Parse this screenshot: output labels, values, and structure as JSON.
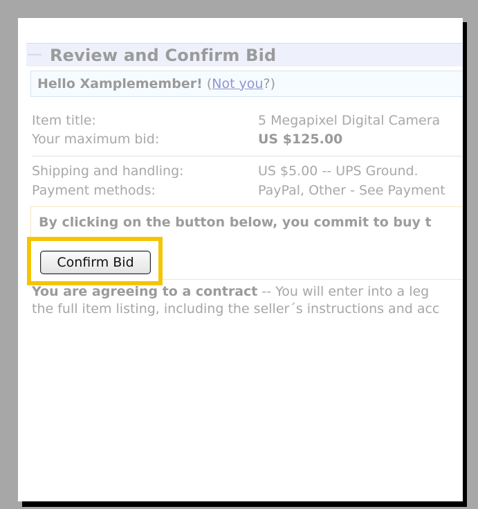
{
  "page": {
    "title": "Review and Confirm Bid",
    "greeting": "Hello Xamplemember!",
    "not_you_open": "(",
    "not_you_link": "Not you",
    "not_you_close": "?)"
  },
  "item": {
    "title_label": "Item title:",
    "title_value": "5 Megapixel Digital Camera",
    "max_bid_label": "Your maximum bid:",
    "max_bid_value": "US $125.00",
    "shipping_label": "Shipping and handling:",
    "shipping_value": "US $5.00 -- UPS Ground.",
    "payment_label": "Payment methods:",
    "payment_value": "PayPal, Other - See Payment"
  },
  "commit": {
    "notice": "By clicking on the button below, you commit to buy t",
    "confirm_label": "Confirm Bid"
  },
  "agreement": {
    "bold": "You are agreeing to a contract",
    "rest": " -- You will enter into a leg",
    "line2": "the full item listing, including the seller´s instructions and acc"
  },
  "colors": {
    "highlight": "#f5c400",
    "link": "#8f95d3"
  }
}
